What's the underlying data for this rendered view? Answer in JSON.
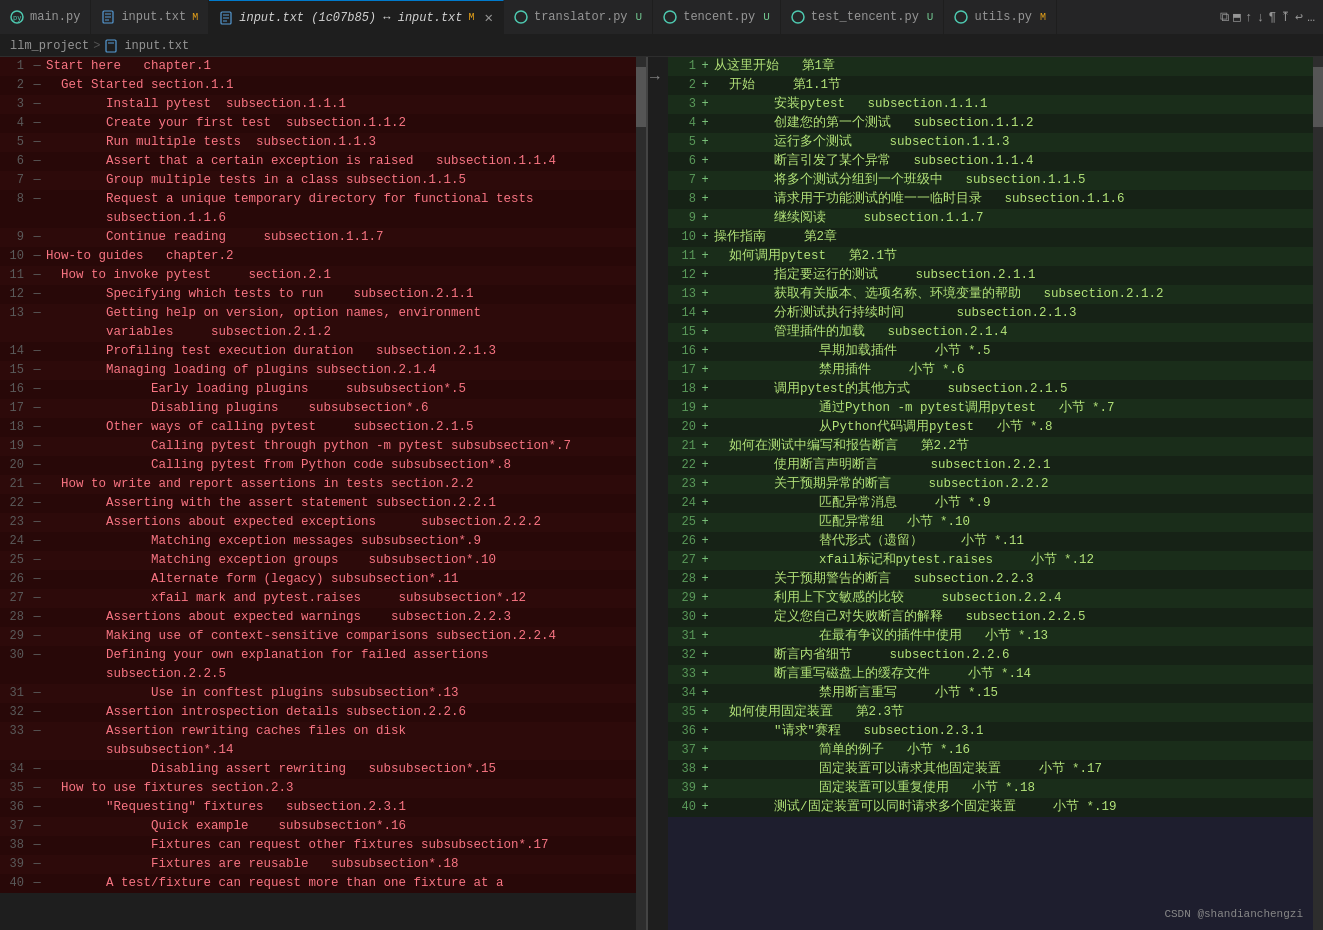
{
  "tabs": [
    {
      "id": "main-py",
      "label": "main.py",
      "icon": "py",
      "active": false,
      "modified": false,
      "closeable": false
    },
    {
      "id": "input-txt",
      "label": "input.txt",
      "icon": "txt",
      "active": false,
      "modified": true,
      "closeable": false
    },
    {
      "id": "input-txt-diff",
      "label": "input.txt (1c07b85) ↔ input.txt",
      "icon": "txt",
      "active": true,
      "modified": true,
      "closeable": true
    },
    {
      "id": "translator-py",
      "label": "translator.py",
      "icon": "py",
      "active": false,
      "modified": false,
      "badge": "U"
    },
    {
      "id": "tencent-py",
      "label": "tencent.py",
      "icon": "py",
      "active": false,
      "modified": false,
      "badge": "U"
    },
    {
      "id": "test-tencent-py",
      "label": "test_tencent.py",
      "icon": "py",
      "active": false,
      "modified": false,
      "badge": "U"
    },
    {
      "id": "utils-py",
      "label": "utils.py",
      "icon": "py",
      "active": false,
      "modified": false,
      "badge": "M"
    }
  ],
  "breadcrumb": {
    "project": "llm_project",
    "file": "input.txt"
  },
  "left_lines": [
    {
      "num": "1",
      "dash": "—",
      "content": "Start here   chapter.1"
    },
    {
      "num": "2",
      "dash": "—",
      "content": "  Get Started section.1.1"
    },
    {
      "num": "3",
      "dash": "—",
      "content": "        Install pytest  subsection.1.1.1"
    },
    {
      "num": "4",
      "dash": "—",
      "content": "        Create your first test  subsection.1.1.2"
    },
    {
      "num": "5",
      "dash": "—",
      "content": "        Run multiple tests  subsection.1.1.3"
    },
    {
      "num": "6",
      "dash": "—",
      "content": "        Assert that a certain exception is raised   subsection.1.1.4"
    },
    {
      "num": "7",
      "dash": "—",
      "content": "        Group multiple tests in a class subsection.1.1.5"
    },
    {
      "num": "8",
      "dash": "—",
      "content": "        Request a unique temporary directory for functional tests\n        subsection.1.1.6"
    },
    {
      "num": "9",
      "dash": "—",
      "content": "        Continue reading     subsection.1.1.7"
    },
    {
      "num": "10",
      "dash": "—",
      "content": "How-to guides   chapter.2"
    },
    {
      "num": "11",
      "dash": "—",
      "content": "  How to invoke pytest     section.2.1"
    },
    {
      "num": "12",
      "dash": "—",
      "content": "        Specifying which tests to run    subsection.2.1.1"
    },
    {
      "num": "13",
      "dash": "—",
      "content": "        Getting help on version, option names, environment\n        variables     subsection.2.1.2"
    },
    {
      "num": "14",
      "dash": "—",
      "content": "        Profiling test execution duration   subsection.2.1.3"
    },
    {
      "num": "15",
      "dash": "—",
      "content": "        Managing loading of plugins subsection.2.1.4"
    },
    {
      "num": "16",
      "dash": "—",
      "content": "              Early loading plugins     subsubsection*.5"
    },
    {
      "num": "17",
      "dash": "—",
      "content": "              Disabling plugins    subsubsection*.6"
    },
    {
      "num": "18",
      "dash": "—",
      "content": "        Other ways of calling pytest     subsection.2.1.5"
    },
    {
      "num": "19",
      "dash": "—",
      "content": "              Calling pytest through python -m pytest subsubsection*.7"
    },
    {
      "num": "20",
      "dash": "—",
      "content": "              Calling pytest from Python code subsubsection*.8"
    },
    {
      "num": "21",
      "dash": "—",
      "content": "  How to write and report assertions in tests section.2.2"
    },
    {
      "num": "22",
      "dash": "—",
      "content": "        Asserting with the assert statement subsection.2.2.1"
    },
    {
      "num": "23",
      "dash": "—",
      "content": "        Assertions about expected exceptions      subsection.2.2.2"
    },
    {
      "num": "24",
      "dash": "—",
      "content": "              Matching exception messages subsubsection*.9"
    },
    {
      "num": "25",
      "dash": "—",
      "content": "              Matching exception groups    subsubsection*.10"
    },
    {
      "num": "26",
      "dash": "—",
      "content": "              Alternate form (legacy) subsubsection*.11"
    },
    {
      "num": "27",
      "dash": "—",
      "content": "              xfail mark and pytest.raises     subsubsection*.12"
    },
    {
      "num": "28",
      "dash": "—",
      "content": "        Assertions about expected warnings    subsection.2.2.3"
    },
    {
      "num": "29",
      "dash": "—",
      "content": "        Making use of context-sensitive comparisons subsection.2.2.4"
    },
    {
      "num": "30",
      "dash": "—",
      "content": "        Defining your own explanation for failed assertions\n        subsection.2.2.5"
    },
    {
      "num": "31",
      "dash": "—",
      "content": "              Use in conftest plugins subsubsection*.13"
    },
    {
      "num": "32",
      "dash": "—",
      "content": "        Assertion introspection details subsection.2.2.6"
    },
    {
      "num": "33",
      "dash": "—",
      "content": "        Assertion rewriting caches files on disk\n        subsubsection*.14"
    },
    {
      "num": "34",
      "dash": "—",
      "content": "              Disabling assert rewriting   subsubsection*.15"
    },
    {
      "num": "35",
      "dash": "—",
      "content": "  How to use fixtures section.2.3"
    },
    {
      "num": "36",
      "dash": "—",
      "content": "        \"Requesting\" fixtures   subsection.2.3.1"
    },
    {
      "num": "37",
      "dash": "—",
      "content": "              Quick example    subsubsection*.16"
    },
    {
      "num": "38",
      "dash": "—",
      "content": "              Fixtures can request other fixtures subsubsection*.17"
    },
    {
      "num": "39",
      "dash": "—",
      "content": "              Fixtures are reusable   subsubsection*.18"
    },
    {
      "num": "40",
      "dash": "—",
      "content": "        A test/fixture can request more than one fixture at a"
    }
  ],
  "right_lines": [
    {
      "num": "1",
      "content": "从这里开始   第1章"
    },
    {
      "num": "2",
      "content": "  开始     第1.1节"
    },
    {
      "num": "3",
      "content": "        安装pytest   subsection.1.1.1"
    },
    {
      "num": "4",
      "content": "        创建您的第一个测试   subsection.1.1.2"
    },
    {
      "num": "5",
      "content": "        运行多个测试     subsection.1.1.3"
    },
    {
      "num": "6",
      "content": "        断言引发了某个异常   subsection.1.1.4"
    },
    {
      "num": "7",
      "content": "        将多个测试分组到一个班级中   subsection.1.1.5"
    },
    {
      "num": "8",
      "content": "        请求用于功能测试的唯一一临时目录   subsection.1.1.6"
    },
    {
      "num": "9",
      "content": "        继续阅读     subsection.1.1.7"
    },
    {
      "num": "10",
      "content": "操作指南     第2章"
    },
    {
      "num": "11",
      "content": "  如何调用pytest   第2.1节"
    },
    {
      "num": "12",
      "content": "        指定要运行的测试     subsection.2.1.1"
    },
    {
      "num": "13",
      "content": "        获取有关版本、选项名称、环境变量的帮助   subsection.2.1.2"
    },
    {
      "num": "14",
      "content": "        分析测试执行持续时间       subsection.2.1.3"
    },
    {
      "num": "15",
      "content": "        管理插件的加载   subsection.2.1.4"
    },
    {
      "num": "16",
      "content": "              早期加载插件     小节 *.5"
    },
    {
      "num": "17",
      "content": "              禁用插件     小节 *.6"
    },
    {
      "num": "18",
      "content": "        调用pytest的其他方式     subsection.2.1.5"
    },
    {
      "num": "19",
      "content": "              通过Python -m pytest调用pytest   小节 *.7"
    },
    {
      "num": "20",
      "content": "              从Python代码调用pytest   小节 *.8"
    },
    {
      "num": "21",
      "content": "  如何在测试中编写和报告断言   第2.2节"
    },
    {
      "num": "22",
      "content": "        使用断言声明断言       subsection.2.2.1"
    },
    {
      "num": "23",
      "content": "        关于预期异常的断言     subsection.2.2.2"
    },
    {
      "num": "24",
      "content": "              匹配异常消息     小节 *.9"
    },
    {
      "num": "25",
      "content": "              匹配异常组   小节 *.10"
    },
    {
      "num": "26",
      "content": "              替代形式（遗留）     小节 *.11"
    },
    {
      "num": "27",
      "content": "              xfail标记和pytest.raises     小节 *.12"
    },
    {
      "num": "28",
      "content": "        关于预期警告的断言   subsection.2.2.3"
    },
    {
      "num": "29",
      "content": "        利用上下文敏感的比较     subsection.2.2.4"
    },
    {
      "num": "30",
      "content": "        定义您自己对失败断言的解释   subsection.2.2.5"
    },
    {
      "num": "31",
      "content": "              在最有争议的插件中使用   小节 *.13"
    },
    {
      "num": "32",
      "content": "        断言内省细节     subsection.2.2.6"
    },
    {
      "num": "33",
      "content": "        断言重写磁盘上的缓存文件     小节 *.14"
    },
    {
      "num": "34",
      "content": "              禁用断言重写     小节 *.15"
    },
    {
      "num": "35",
      "content": "  如何使用固定装置   第2.3节"
    },
    {
      "num": "36",
      "content": "        \"请求\"赛程   subsection.2.3.1"
    },
    {
      "num": "37",
      "content": "              简单的例子   小节 *.16"
    },
    {
      "num": "38",
      "content": "              固定装置可以请求其他固定装置     小节 *.17"
    },
    {
      "num": "39",
      "content": "              固定装置可以重复使用   小节 *.18"
    },
    {
      "num": "40",
      "content": "        测试/固定装置可以同时请求多个固定装置     小节 *.19"
    }
  ],
  "watermark": "CSDN @shandianchengzi",
  "icons": {
    "py_file": "🐍",
    "txt_file": "≡",
    "arrow_right": "→",
    "arrow_up": "↑",
    "arrow_down": "↓"
  }
}
